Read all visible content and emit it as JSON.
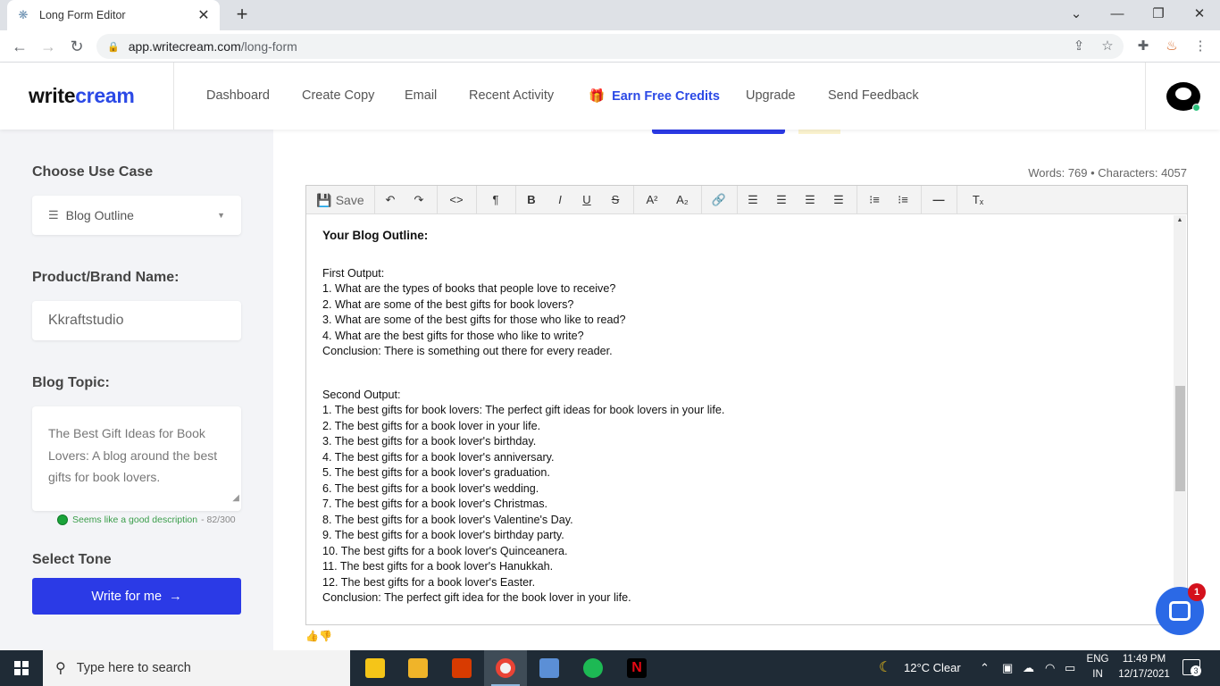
{
  "browser": {
    "tab_title": "Long Form Editor",
    "url_domain": "app.writecream.com",
    "url_path": "/long-form"
  },
  "header": {
    "logo_write": "write",
    "logo_cream": "cream",
    "nav": [
      "Dashboard",
      "Create Copy",
      "Email",
      "Recent Activity",
      "Earn Free Credits",
      "Upgrade",
      "Send Feedback"
    ]
  },
  "sidebar": {
    "use_case_label": "Choose Use Case",
    "use_case_value": "Blog Outline",
    "brand_label": "Product/Brand Name:",
    "brand_value": "Kkraftstudio",
    "topic_label": "Blog Topic:",
    "topic_value": "The Best Gift Ideas for Book Lovers: A blog around the best gifts for book lovers.",
    "topic_hint": "Seems like a good description",
    "topic_count": "- 82/300",
    "tone_label": "Select Tone",
    "write_button": "Write for me"
  },
  "editor": {
    "counts": "Words: 769 • Characters: 4057",
    "save_label": "Save",
    "heading": "Your Blog Outline:",
    "first_output": [
      "First Output:",
      "1. What are the types of books that people love to receive?",
      "2. What are some of the best gifts for book lovers?",
      "3. What are some of the best gifts for those who like to read?",
      "4. What are the best gifts for those who like to write?",
      "Conclusion: There is something out there for every reader."
    ],
    "second_output": [
      "Second Output:",
      "1. The best gifts for book lovers: The perfect gift ideas for book lovers in your life.",
      "2. The best gifts for a book lover in your life.",
      "3. The best gifts for a book lover's birthday.",
      "4. The best gifts for a book lover's anniversary.",
      "5. The best gifts for a book lover's graduation.",
      "6. The best gifts for a book lover's wedding.",
      "7. The best gifts for a book lover's Christmas.",
      "8. The best gifts for a book lover's Valentine's Day.",
      "9. The best gifts for a book lover's birthday party.",
      "10. The best gifts for a book lover's Quinceanera.",
      "11. The best gifts for a book lover's Hanukkah.",
      "12. The best gifts for a book lover's Easter.",
      "Conclusion: The perfect gift idea for the book lover in your life."
    ]
  },
  "chat": {
    "badge": "1"
  },
  "taskbar": {
    "search_placeholder": "Type here to search",
    "weather": "12°C  Clear",
    "lang_top": "ENG",
    "lang_bottom": "IN",
    "time": "11:49 PM",
    "date": "12/17/2021",
    "notifications": "3"
  },
  "colors": {
    "accent": "#2b3ae6",
    "brand_blue": "#2b49e6",
    "sidebar_bg": "#f3f4f7",
    "taskbar_bg": "#1f2b36"
  }
}
